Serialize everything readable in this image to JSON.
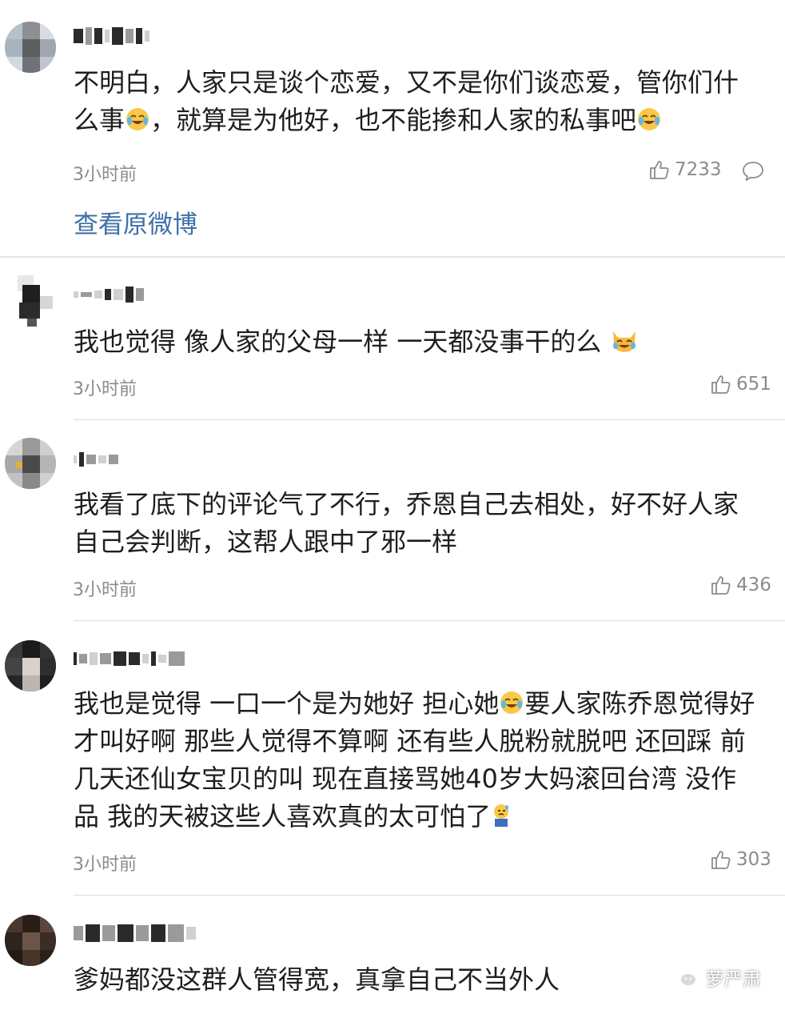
{
  "comments": [
    {
      "text_parts": [
        "不明白，人家只是谈个恋爱，又不是你们谈恋爱，管你们什么事",
        "，就算是为他好，也不能掺和人家的私事吧"
      ],
      "time": "3小时前",
      "likes": "7233",
      "view_original": "查看原微博"
    },
    {
      "text": "我也觉得 像人家的父母一样 一天都没事干的么 ",
      "time": "3小时前",
      "likes": "651"
    },
    {
      "text": "我看了底下的评论气了不行，乔恩自己去相处，好不好人家自己会判断，这帮人跟中了邪一样",
      "time": "3小时前",
      "likes": "436"
    },
    {
      "text_parts": [
        "我也是觉得 一口一个是为她好 担心她",
        "要人家陈乔恩觉得好才叫好啊 那些人觉得不算啊 还有些人脱粉就脱吧 还回踩 前几天还仙女宝贝的叫 现在直接骂她40岁大妈滚回台湾 没作品 我的天被这些人喜欢真的太可怕了"
      ],
      "time": "3小时前",
      "likes": "303"
    },
    {
      "text": "爹妈都没这群人管得宽，真拿自己不当外人"
    }
  ],
  "watermark": {
    "label": "萝严肃",
    "icon": "wechat-icon"
  },
  "icons": {
    "like": "thumbs-up-icon",
    "reply": "comment-bubble-icon",
    "laugh_cry": "laugh-cry-emoji",
    "cat": "cat-laugh-emoji",
    "sweat": "sweat-emoji"
  },
  "colors": {
    "link": "#3e6fa8",
    "meta": "#8b8b8b",
    "separator": "#dcdcdc"
  }
}
